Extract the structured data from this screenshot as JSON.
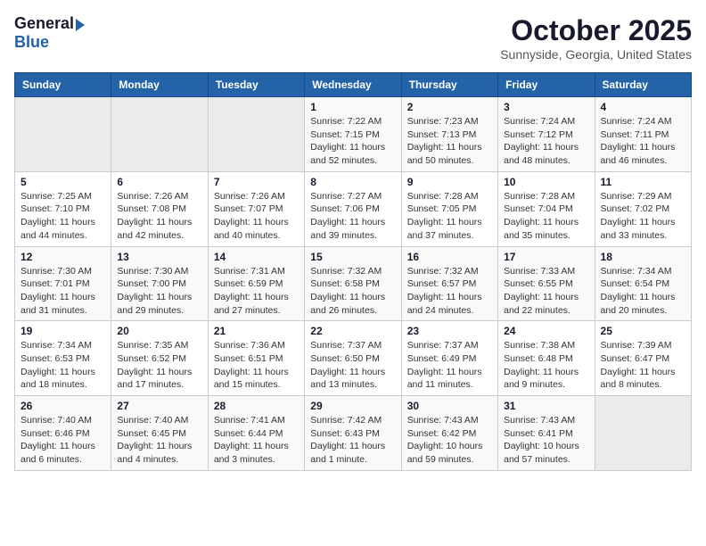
{
  "header": {
    "logo_general": "General",
    "logo_blue": "Blue",
    "month_title": "October 2025",
    "location": "Sunnyside, Georgia, United States"
  },
  "days_of_week": [
    "Sunday",
    "Monday",
    "Tuesday",
    "Wednesday",
    "Thursday",
    "Friday",
    "Saturday"
  ],
  "weeks": [
    [
      {
        "num": "",
        "detail": ""
      },
      {
        "num": "",
        "detail": ""
      },
      {
        "num": "",
        "detail": ""
      },
      {
        "num": "1",
        "detail": "Sunrise: 7:22 AM\nSunset: 7:15 PM\nDaylight: 11 hours and 52 minutes."
      },
      {
        "num": "2",
        "detail": "Sunrise: 7:23 AM\nSunset: 7:13 PM\nDaylight: 11 hours and 50 minutes."
      },
      {
        "num": "3",
        "detail": "Sunrise: 7:24 AM\nSunset: 7:12 PM\nDaylight: 11 hours and 48 minutes."
      },
      {
        "num": "4",
        "detail": "Sunrise: 7:24 AM\nSunset: 7:11 PM\nDaylight: 11 hours and 46 minutes."
      }
    ],
    [
      {
        "num": "5",
        "detail": "Sunrise: 7:25 AM\nSunset: 7:10 PM\nDaylight: 11 hours and 44 minutes."
      },
      {
        "num": "6",
        "detail": "Sunrise: 7:26 AM\nSunset: 7:08 PM\nDaylight: 11 hours and 42 minutes."
      },
      {
        "num": "7",
        "detail": "Sunrise: 7:26 AM\nSunset: 7:07 PM\nDaylight: 11 hours and 40 minutes."
      },
      {
        "num": "8",
        "detail": "Sunrise: 7:27 AM\nSunset: 7:06 PM\nDaylight: 11 hours and 39 minutes."
      },
      {
        "num": "9",
        "detail": "Sunrise: 7:28 AM\nSunset: 7:05 PM\nDaylight: 11 hours and 37 minutes."
      },
      {
        "num": "10",
        "detail": "Sunrise: 7:28 AM\nSunset: 7:04 PM\nDaylight: 11 hours and 35 minutes."
      },
      {
        "num": "11",
        "detail": "Sunrise: 7:29 AM\nSunset: 7:02 PM\nDaylight: 11 hours and 33 minutes."
      }
    ],
    [
      {
        "num": "12",
        "detail": "Sunrise: 7:30 AM\nSunset: 7:01 PM\nDaylight: 11 hours and 31 minutes."
      },
      {
        "num": "13",
        "detail": "Sunrise: 7:30 AM\nSunset: 7:00 PM\nDaylight: 11 hours and 29 minutes."
      },
      {
        "num": "14",
        "detail": "Sunrise: 7:31 AM\nSunset: 6:59 PM\nDaylight: 11 hours and 27 minutes."
      },
      {
        "num": "15",
        "detail": "Sunrise: 7:32 AM\nSunset: 6:58 PM\nDaylight: 11 hours and 26 minutes."
      },
      {
        "num": "16",
        "detail": "Sunrise: 7:32 AM\nSunset: 6:57 PM\nDaylight: 11 hours and 24 minutes."
      },
      {
        "num": "17",
        "detail": "Sunrise: 7:33 AM\nSunset: 6:55 PM\nDaylight: 11 hours and 22 minutes."
      },
      {
        "num": "18",
        "detail": "Sunrise: 7:34 AM\nSunset: 6:54 PM\nDaylight: 11 hours and 20 minutes."
      }
    ],
    [
      {
        "num": "19",
        "detail": "Sunrise: 7:34 AM\nSunset: 6:53 PM\nDaylight: 11 hours and 18 minutes."
      },
      {
        "num": "20",
        "detail": "Sunrise: 7:35 AM\nSunset: 6:52 PM\nDaylight: 11 hours and 17 minutes."
      },
      {
        "num": "21",
        "detail": "Sunrise: 7:36 AM\nSunset: 6:51 PM\nDaylight: 11 hours and 15 minutes."
      },
      {
        "num": "22",
        "detail": "Sunrise: 7:37 AM\nSunset: 6:50 PM\nDaylight: 11 hours and 13 minutes."
      },
      {
        "num": "23",
        "detail": "Sunrise: 7:37 AM\nSunset: 6:49 PM\nDaylight: 11 hours and 11 minutes."
      },
      {
        "num": "24",
        "detail": "Sunrise: 7:38 AM\nSunset: 6:48 PM\nDaylight: 11 hours and 9 minutes."
      },
      {
        "num": "25",
        "detail": "Sunrise: 7:39 AM\nSunset: 6:47 PM\nDaylight: 11 hours and 8 minutes."
      }
    ],
    [
      {
        "num": "26",
        "detail": "Sunrise: 7:40 AM\nSunset: 6:46 PM\nDaylight: 11 hours and 6 minutes."
      },
      {
        "num": "27",
        "detail": "Sunrise: 7:40 AM\nSunset: 6:45 PM\nDaylight: 11 hours and 4 minutes."
      },
      {
        "num": "28",
        "detail": "Sunrise: 7:41 AM\nSunset: 6:44 PM\nDaylight: 11 hours and 3 minutes."
      },
      {
        "num": "29",
        "detail": "Sunrise: 7:42 AM\nSunset: 6:43 PM\nDaylight: 11 hours and 1 minute."
      },
      {
        "num": "30",
        "detail": "Sunrise: 7:43 AM\nSunset: 6:42 PM\nDaylight: 10 hours and 59 minutes."
      },
      {
        "num": "31",
        "detail": "Sunrise: 7:43 AM\nSunset: 6:41 PM\nDaylight: 10 hours and 57 minutes."
      },
      {
        "num": "",
        "detail": ""
      }
    ]
  ]
}
